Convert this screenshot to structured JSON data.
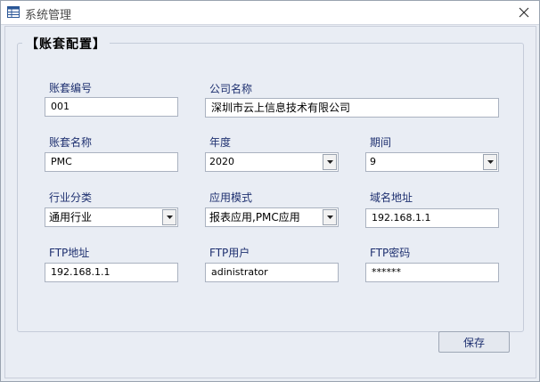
{
  "window": {
    "title": "系统管理",
    "icon": "table-icon"
  },
  "group": {
    "title": "【账套配置】"
  },
  "fields": {
    "account_no": {
      "label": "账套编号",
      "value": "001"
    },
    "company_name": {
      "label": "公司名称",
      "value": "深圳市云上信息技术有限公司"
    },
    "account_name": {
      "label": "账套名称",
      "value": "PMC"
    },
    "year": {
      "label": "年度",
      "value": "2020"
    },
    "period": {
      "label": "期间",
      "value": "9"
    },
    "industry": {
      "label": "行业分类",
      "value": "通用行业"
    },
    "app_mode": {
      "label": "应用模式",
      "value": "报表应用,PMC应用"
    },
    "domain": {
      "label": "域名地址",
      "value": "192.168.1.1"
    },
    "ftp_address": {
      "label": "FTP地址",
      "value": "192.168.1.1"
    },
    "ftp_user": {
      "label": "FTP用户",
      "value": "adinistrator"
    },
    "ftp_password": {
      "label": "FTP密码",
      "value": "******"
    }
  },
  "buttons": {
    "save": "保存"
  },
  "colors": {
    "background": "#e9edf4",
    "label_text": "#1e3070",
    "border": "#aab2c0"
  }
}
